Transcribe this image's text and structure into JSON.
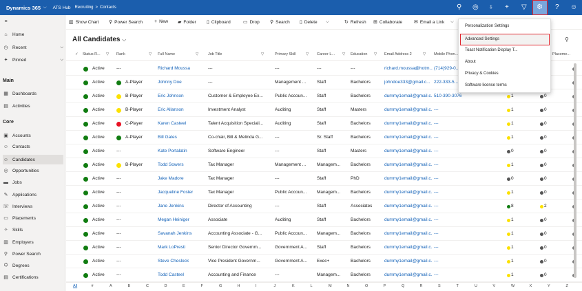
{
  "topbar": {
    "brand": "Dynamics 365",
    "app": "ATS Hub",
    "breadcrumb": [
      "Recruiting",
      ">",
      "Contacts"
    ]
  },
  "sidebar": {
    "top": [
      {
        "icon": "≡",
        "label": ""
      },
      {
        "icon": "⌂",
        "label": "Home"
      },
      {
        "icon": "◷",
        "label": "Recent"
      },
      {
        "icon": "✦",
        "label": "Pinned"
      }
    ],
    "main_title": "Main",
    "main": [
      {
        "icon": "▦",
        "label": "Dashboards"
      },
      {
        "icon": "▤",
        "label": "Activities"
      }
    ],
    "core_title": "Core",
    "core": [
      {
        "icon": "▣",
        "label": "Accounts"
      },
      {
        "icon": "☺",
        "label": "Contacts"
      },
      {
        "icon": "☺",
        "label": "Candidates"
      },
      {
        "icon": "◎",
        "label": "Opportunities"
      },
      {
        "icon": "▬",
        "label": "Jobs"
      },
      {
        "icon": "✎",
        "label": "Applications"
      },
      {
        "icon": "☏",
        "label": "Interviews"
      },
      {
        "icon": "▭",
        "label": "Placements"
      },
      {
        "icon": "✧",
        "label": "Skills"
      },
      {
        "icon": "▥",
        "label": "Employers"
      },
      {
        "icon": "⚲",
        "label": "Power Search"
      },
      {
        "icon": "⛭",
        "label": "Degrees"
      },
      {
        "icon": "▤",
        "label": "Certifications"
      }
    ]
  },
  "commands": [
    "Show Chart",
    "Power Search",
    "New",
    "Folder",
    "Clipboard",
    "Drop",
    "Search",
    "Delete",
    "Refresh",
    "Collaborate",
    "Email a Link"
  ],
  "view_title": "All Candidates",
  "columns": [
    "Status R...",
    "Rank",
    "Full Name",
    "Job Title",
    "Primary Skill",
    "Career L...",
    "Education",
    "Email Address 2",
    "Mobile Phon...",
    "Placeme..."
  ],
  "rows": [
    {
      "status": "Active",
      "rank": "---",
      "rank_color": "",
      "name": "Richard Moussa",
      "title": "---",
      "skill": "---",
      "career": "---",
      "edu": "---",
      "email": "richard.moussa@hotm...",
      "phone": "(714)929-0...",
      "p1": "",
      "p2": ""
    },
    {
      "status": "Active",
      "rank": "A-Player",
      "rank_color": "#107c10",
      "name": "Johnny Doe",
      "title": "---",
      "skill": "Management ...",
      "career": "Staff",
      "edu": "Bachelors",
      "email": "johndoe333@gmail.c...",
      "phone": "222-333-5...",
      "p1": "",
      "p2": ""
    },
    {
      "status": "Active",
      "rank": "B-Player",
      "rank_color": "#fce100",
      "name": "Eric Johnson",
      "title": "Customer & Employee Ex...",
      "skill": "Public Accoun...",
      "career": "Staff",
      "edu": "Bachelors",
      "email": "dummy1email@gmail.c...",
      "phone": "510-390-3076",
      "p1": "1",
      "p2": "0"
    },
    {
      "status": "Active",
      "rank": "B-Player",
      "rank_color": "#fce100",
      "name": "Eric Allanson",
      "title": "Investment Analyst",
      "skill": "Auditing",
      "career": "Staff",
      "edu": "Masters",
      "email": "dummy1email@gmail.c...",
      "phone": "---",
      "p1": "1",
      "p2": "0"
    },
    {
      "status": "Active",
      "rank": "C-Player",
      "rank_color": "#e81123",
      "name": "Karen Casteel",
      "title": "Talent Acquisition Speciali...",
      "skill": "Auditing",
      "career": "Staff",
      "edu": "Bachelors",
      "email": "dummy1email@gmail.c...",
      "phone": "---",
      "p1": "1",
      "p2": "0"
    },
    {
      "status": "Active",
      "rank": "A-Player",
      "rank_color": "#107c10",
      "name": "Bill Gates",
      "title": "Co-chair, Bill & Melinda G...",
      "skill": "---",
      "career": "Sr. Staff",
      "edu": "Bachelors",
      "email": "dummy1email@gmail.c...",
      "phone": "---",
      "p1": "1",
      "p2": "0"
    },
    {
      "status": "Active",
      "rank": "---",
      "rank_color": "",
      "name": "Kate Portalatin",
      "title": "Software Engineer",
      "skill": "---",
      "career": "Staff",
      "edu": "Masters",
      "email": "dummy1email@gmail.c...",
      "phone": "---",
      "p1": "0",
      "p2": "0"
    },
    {
      "status": "Active",
      "rank": "B-Player",
      "rank_color": "#fce100",
      "name": "Todd Sowers",
      "title": "Tax Manager",
      "skill": "Management ...",
      "career": "Managem...",
      "edu": "Bachelors",
      "email": "dummy1email@gmail.c...",
      "phone": "---",
      "p1": "1",
      "p2": "0"
    },
    {
      "status": "Active",
      "rank": "---",
      "rank_color": "",
      "name": "Jake Madore",
      "title": "Tax Manager",
      "skill": "---",
      "career": "Staff",
      "edu": "PhD",
      "email": "dummy1email@gmail.c...",
      "phone": "---",
      "p1": "0",
      "p2": "0"
    },
    {
      "status": "Active",
      "rank": "---",
      "rank_color": "",
      "name": "Jacqueline Foster",
      "title": "Tax Manager",
      "skill": "Public Accoun...",
      "career": "Managem...",
      "edu": "Bachelors",
      "email": "dummy1email@gmail.c...",
      "phone": "---",
      "p1": "1",
      "p2": "0"
    },
    {
      "status": "Active",
      "rank": "---",
      "rank_color": "",
      "name": "Jane Jenkins",
      "title": "Director of Accounting",
      "skill": "---",
      "career": "Staff",
      "edu": "Associates",
      "email": "dummy1email@gmail.c...",
      "phone": "---",
      "p1": "8",
      "p2": "2"
    },
    {
      "status": "Active",
      "rank": "---",
      "rank_color": "",
      "name": "Megan Heiniger",
      "title": "Associate",
      "skill": "Auditing",
      "career": "Staff",
      "edu": "Bachelors",
      "email": "dummy1email@gmail.c...",
      "phone": "---",
      "p1": "1",
      "p2": "0"
    },
    {
      "status": "Active",
      "rank": "---",
      "rank_color": "",
      "name": "Savanah Jenkins",
      "title": "Accounting Associate - G...",
      "skill": "Public Accoun...",
      "career": "Managem...",
      "edu": "Bachelors",
      "email": "dummy1email@gmail.c...",
      "phone": "---",
      "p1": "1",
      "p2": "0"
    },
    {
      "status": "Active",
      "rank": "---",
      "rank_color": "",
      "name": "Mark LoPresti",
      "title": "Senior Director Governm...",
      "skill": "Government A...",
      "career": "Staff",
      "edu": "Bachelors",
      "email": "dummy1email@gmail.c...",
      "phone": "---",
      "p1": "1",
      "p2": "0"
    },
    {
      "status": "Active",
      "rank": "---",
      "rank_color": "",
      "name": "Steve Cheslock",
      "title": "Vice President Governm...",
      "skill": "Government A...",
      "career": "Exec+",
      "edu": "Bachelors",
      "email": "dummy1email@gmail.c...",
      "phone": "---",
      "p1": "1",
      "p2": "0"
    },
    {
      "status": "Active",
      "rank": "---",
      "rank_color": "",
      "name": "Todd Casteel",
      "title": "Accounting and Finance",
      "skill": "---",
      "career": "Managem...",
      "edu": "Bachelors",
      "email": "dummy1email@gmail.c...",
      "phone": "---",
      "p1": "1",
      "p2": "0"
    }
  ],
  "menu": [
    "Personalization Settings",
    "Advanced Settings",
    "Toast Notification Display T...",
    "About",
    "Privacy & Cookies",
    "Software license terms"
  ],
  "alphabet": [
    "All",
    "#",
    "A",
    "B",
    "C",
    "D",
    "E",
    "F",
    "G",
    "H",
    "I",
    "J",
    "K",
    "L",
    "M",
    "N",
    "O",
    "P",
    "Q",
    "R",
    "S",
    "T",
    "U",
    "V",
    "W",
    "X",
    "Y",
    "Z"
  ],
  "colors": {
    "topbar": "#1b5ead",
    "link": "#1160b7",
    "status_active": "#107c10",
    "highlight": "#e0262d"
  }
}
